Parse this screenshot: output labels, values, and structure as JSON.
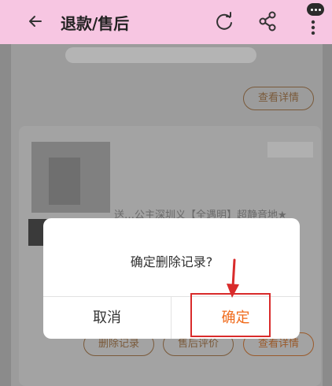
{
  "header": {
    "title": "退款/售后",
    "icons": [
      "back-arrow-icon",
      "refresh-icon",
      "share-icon",
      "more-icon"
    ]
  },
  "background": {
    "view_detail_label": "查看详情",
    "delete_record_label": "删除记录",
    "after_sale_review_label": "售后评价",
    "view_detail_label_2": "查看详情",
    "product_title": "送…公主深圳义【全遇明】超静音地★"
  },
  "dialog": {
    "message": "确定删除记录?",
    "cancel_label": "取消",
    "confirm_label": "确定"
  },
  "colors": {
    "header_bg": "#f7c6e2",
    "confirm_text": "#f06a1a",
    "highlight_border": "#d92b2b",
    "overlay": "#8b8b8b"
  }
}
